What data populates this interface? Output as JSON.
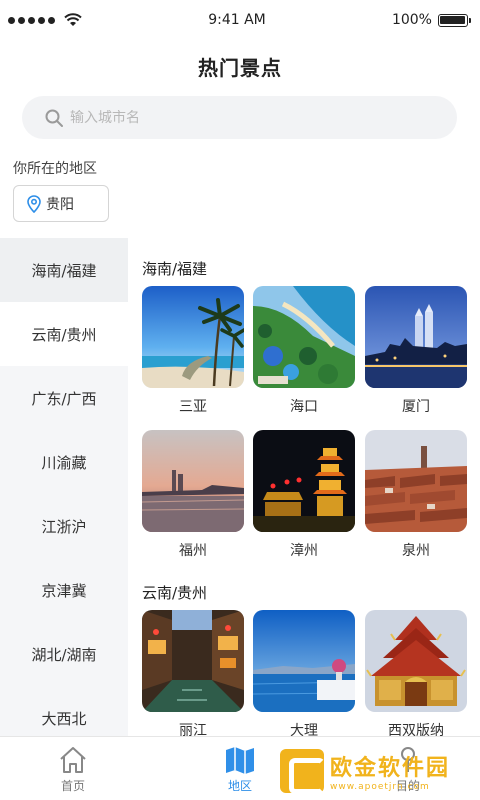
{
  "status": {
    "time": "9:41 AM",
    "battery": "100%",
    "battery_level": 1.0
  },
  "header": {
    "title": "热门景点"
  },
  "search": {
    "placeholder": "输入城市名"
  },
  "region": {
    "label": "你所在的地区",
    "current": "贵阳"
  },
  "sidebar": {
    "items": [
      {
        "label": "海南/福建"
      },
      {
        "label": "云南/贵州"
      },
      {
        "label": "广东/广西"
      },
      {
        "label": "川渝藏"
      },
      {
        "label": "江浙沪"
      },
      {
        "label": "京津冀"
      },
      {
        "label": "湖北/湖南"
      },
      {
        "label": "大西北"
      }
    ]
  },
  "sections": [
    {
      "title": "海南/福建",
      "spots": [
        {
          "name": "三亚",
          "icon": "beach-palm-photo"
        },
        {
          "name": "海口",
          "icon": "coast-resort-photo"
        },
        {
          "name": "厦门",
          "icon": "city-night-photo"
        },
        {
          "name": "福州",
          "icon": "river-sunset-photo"
        },
        {
          "name": "漳州",
          "icon": "pagoda-night-photo"
        },
        {
          "name": "泉州",
          "icon": "red-roof-town-photo"
        }
      ]
    },
    {
      "title": "云南/贵州",
      "spots": [
        {
          "name": "丽江",
          "icon": "old-town-canal-photo"
        },
        {
          "name": "大理",
          "icon": "lake-sky-photo"
        },
        {
          "name": "西双版纳",
          "icon": "dai-temple-photo"
        }
      ]
    }
  ],
  "tabbar": {
    "items": [
      {
        "label": "首页",
        "icon": "home-icon"
      },
      {
        "label": "地区",
        "icon": "map-icon"
      },
      {
        "label": "目的",
        "icon": "pin-icon"
      }
    ]
  },
  "watermark": {
    "title": "欧金软件园",
    "url": "www.apoetjrn.com"
  },
  "colors": {
    "accent": "#2f8fe8",
    "sidebar_bg": "#f5f6f8",
    "search_bg": "#f2f3f5"
  }
}
